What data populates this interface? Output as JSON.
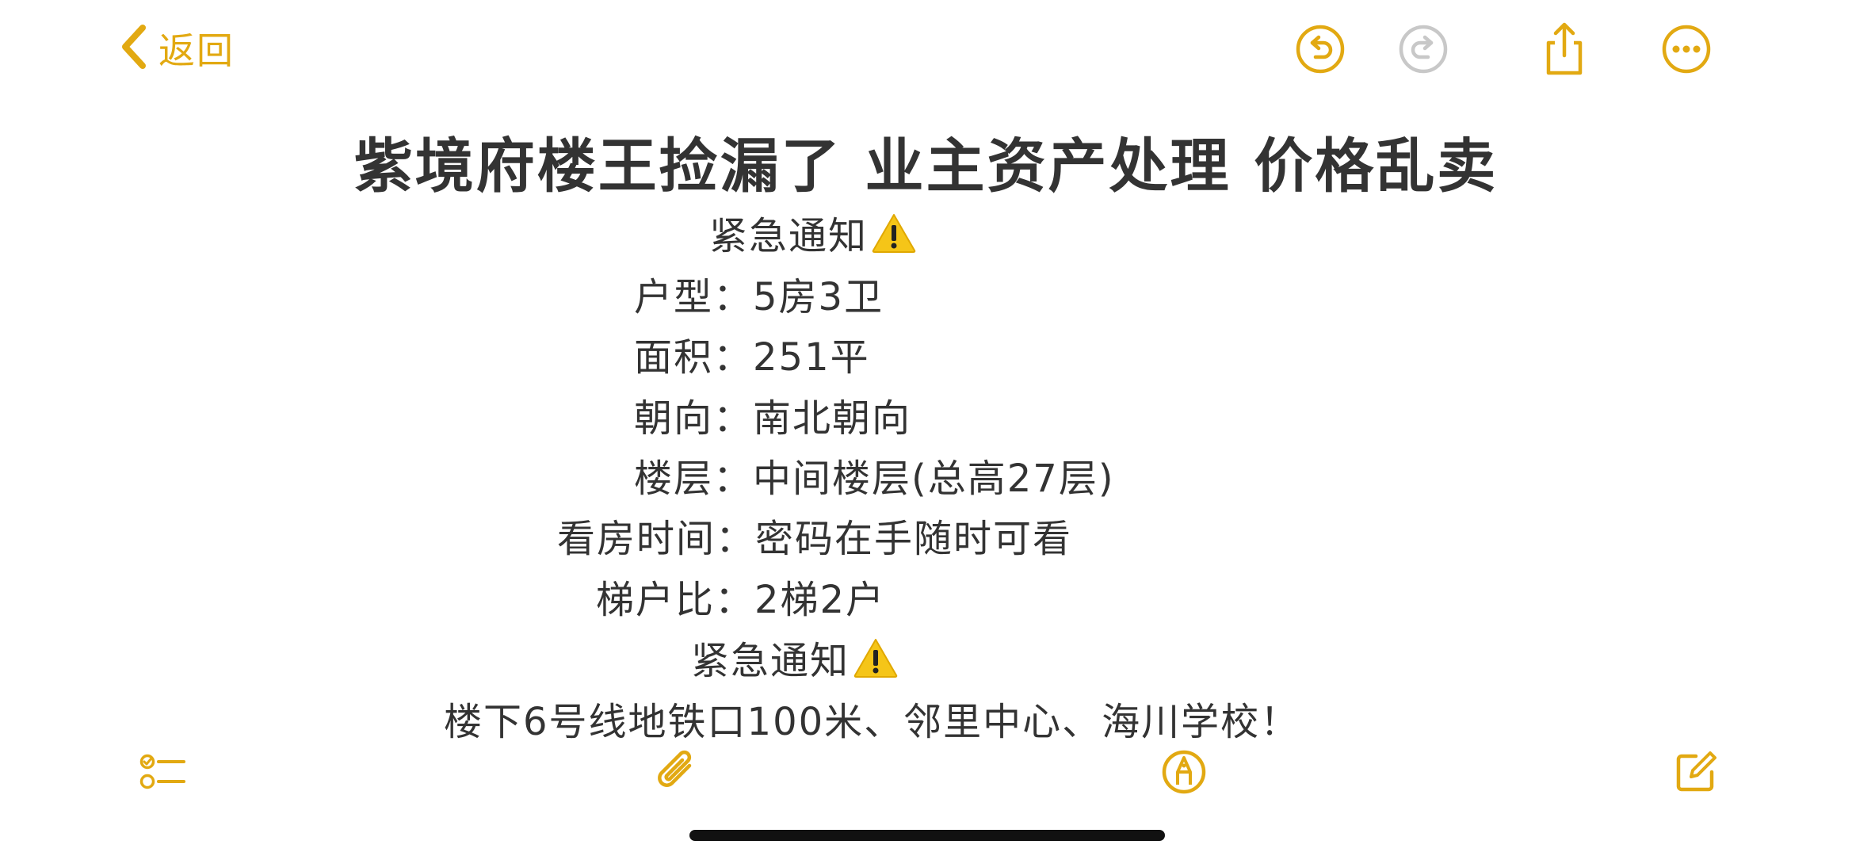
{
  "colors": {
    "accent": "#E2A912",
    "text": "#333333",
    "disabled": "#C8C8C8",
    "background": "#FFFFFF"
  },
  "topbar": {
    "back_label": "返回",
    "icons": [
      "chevron-left-icon",
      "undo-icon",
      "redo-icon",
      "share-icon",
      "more-icon"
    ]
  },
  "note": {
    "title": "紫境府楼王捡漏了 业主资产处理 价格乱卖",
    "urgent_1": "紧急通知",
    "layout_label": "户型：",
    "layout_value": "5房3卫",
    "area_label": "面积：",
    "area_value": "251平",
    "orientation_label": "朝向：",
    "orientation_value": "南北朝向",
    "floor_label": "楼层：",
    "floor_value": "中间楼层(总高27层)",
    "viewing_label": "看房时间：",
    "viewing_value": "密码在手随时可看",
    "elevator_label": "梯户比：",
    "elevator_value": "2梯2户",
    "urgent_2": "紧急通知",
    "footer_line": "楼下6号线地铁口100米、邻里中心、海川学校！"
  },
  "bottombar": {
    "icons": [
      "checklist-icon",
      "paperclip-icon",
      "markup-pen-icon",
      "compose-icon"
    ]
  }
}
